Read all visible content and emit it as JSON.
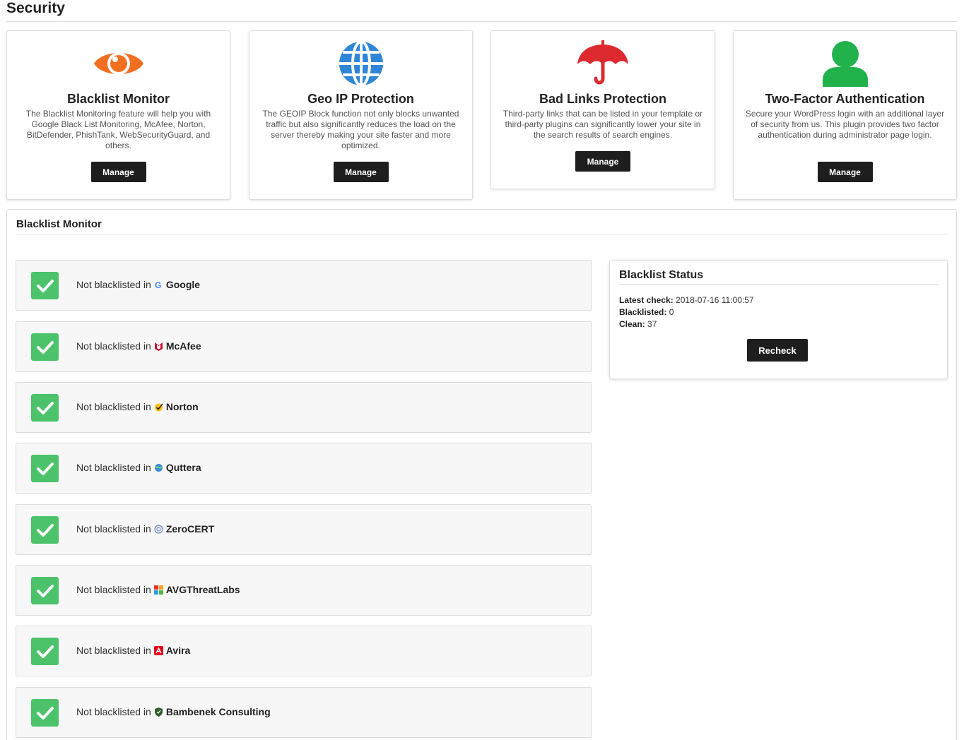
{
  "page": {
    "title": "Security"
  },
  "colors": {
    "eye": "#f26f21",
    "globe": "#2f86d6",
    "umbrella": "#dd2a2f",
    "user": "#22b24c",
    "check": "#4cc36a",
    "button": "#1e1e1e"
  },
  "cards": [
    {
      "title": "Blacklist Monitor",
      "description": "The Blacklist Monitoring feature will help you with Google Black List Monitoring, McAfee, Norton, BitDefender, PhishTank, WebSecurityGuard, and others.",
      "button": "Manage",
      "icon": "eye-icon"
    },
    {
      "title": "Geo IP Protection",
      "description": "The GEOIP Block function not only blocks unwanted traffic but also significantly reduces the load on the server thereby making your site faster and more optimized.",
      "button": "Manage",
      "icon": "globe-icon"
    },
    {
      "title": "Bad Links Protection",
      "description": "Third-party links that can be listed in your template or third-party plugins can significantly lower your site in the search results of search engines.",
      "button": "Manage",
      "icon": "umbrella-icon"
    },
    {
      "title": "Two-Factor Authentication",
      "description": "Secure your WordPress login with an additional layer of security from us. This plugin provides two factor authentication during administrator page login.",
      "button": "Manage",
      "icon": "user-icon"
    }
  ],
  "monitor": {
    "title": "Blacklist Monitor",
    "prefix": "Not blacklisted in",
    "items": [
      {
        "vendor": "Google",
        "icon": "google-icon"
      },
      {
        "vendor": "McAfee",
        "icon": "mcafee-icon"
      },
      {
        "vendor": "Norton",
        "icon": "norton-icon"
      },
      {
        "vendor": "Quttera",
        "icon": "quttera-icon"
      },
      {
        "vendor": "ZeroCERT",
        "icon": "zerocert-icon"
      },
      {
        "vendor": "AVGThreatLabs",
        "icon": "avg-icon"
      },
      {
        "vendor": "Avira",
        "icon": "avira-icon"
      },
      {
        "vendor": "Bambenek Consulting",
        "icon": "bambenek-icon"
      }
    ]
  },
  "status": {
    "title": "Blacklist Status",
    "latest_label": "Latest check:",
    "latest_value": "2018-07-16 11:00:57",
    "blacklisted_label": "Blacklisted:",
    "blacklisted_value": "0",
    "clean_label": "Clean:",
    "clean_value": "37",
    "button": "Recheck"
  }
}
